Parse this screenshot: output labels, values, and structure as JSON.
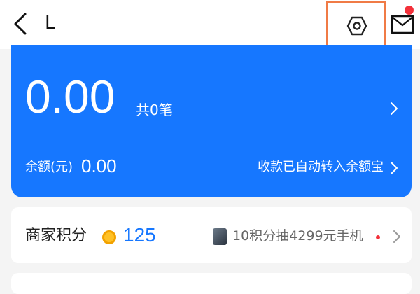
{
  "header": {
    "title": "L",
    "back_icon": "chevron-left-icon",
    "settings_icon": "gear-icon",
    "mail_icon": "mail-icon",
    "highlight_color": "#f07b46",
    "notification_dot_color": "#f3303a"
  },
  "balance_card": {
    "amount": "0.00",
    "count_label": "共0笔",
    "balance_label": "余额(元)",
    "balance_value": "0.00",
    "auto_transfer_label": "收款已自动转入余额宝",
    "background_color": "#1677ff"
  },
  "points_card": {
    "label": "商家积分",
    "value": "125",
    "coin_icon": "coin-icon",
    "promo_text": "10积分抽4299元手机",
    "value_color": "#1677ff"
  }
}
